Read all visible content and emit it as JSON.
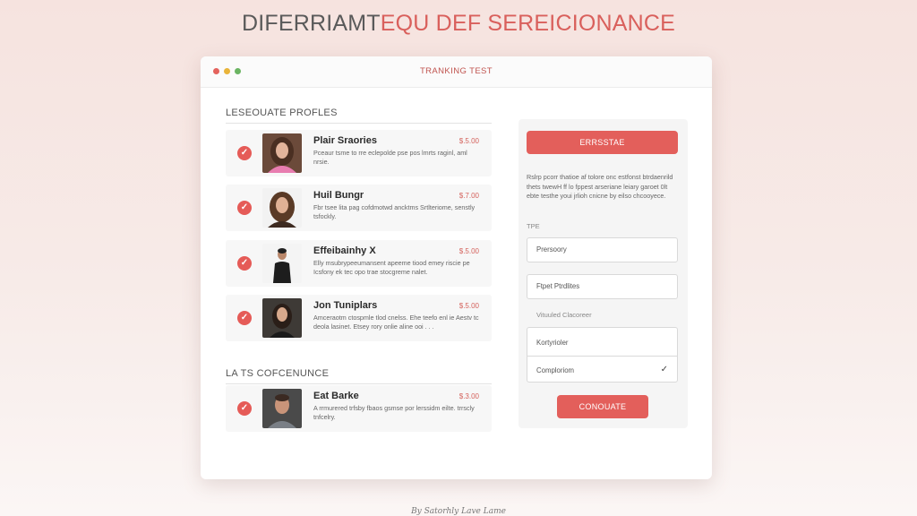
{
  "headline": {
    "part1": "DIFERRIAMT",
    "part2": "EQU DEF SEREICIONANCE"
  },
  "window": {
    "title": "TRANKING TEST"
  },
  "sections": {
    "profiles_heading": "LESEOUATE PROFLES",
    "latest_heading": "LA TS COFCENUNCE"
  },
  "profiles": [
    {
      "name": "Plair Sraories",
      "price": "$.5.00",
      "desc": "Pceaur tsme to rre eclepolde pse pos lmrts raginl, aml nrsie."
    },
    {
      "name": "Huil Bungr",
      "price": "$.7.00",
      "desc": "Fbr tsee lita pag cofdmotwd ancktms Srtlteriome, senstly tsfockly."
    },
    {
      "name": "Effeibainhy X",
      "price": "$.5.00",
      "desc": "Elly msubrypeeumansent apeeme tiood emey riscie pe Icsfony ek tec opo trae stocgreme nalet."
    },
    {
      "name": "Jon Tuniplars",
      "price": "$.5.00",
      "desc": "Amceraotm ctospmle tlod cnelss. Ehe teefo enl ie Aestv tc deola lasinet. Etsey rory onlie aline ooi . . ."
    }
  ],
  "latest": [
    {
      "name": "Eat Barke",
      "price": "$.3.00",
      "desc": "A rrmurered trfsby fbaos gsmse por lerssidm eilte. trrscly tnfcelry."
    }
  ],
  "side": {
    "primary_button": "ERRSSTAE",
    "description": "Rslrp pcorr thatioe af tolore onc estfonst btrdaenrild thets twewH ff lo fppest arseriane leiary garoet 0lt ebte testhe youi jrlioh cnicne by eilso chcooyece.",
    "tpe_label": "TPE",
    "field_1": "Prersoory",
    "field_2": "Ftpet Ptrdlites",
    "virtual_label": "Vituuled Clacoreer",
    "combo_opt_1": "Kortyrioler",
    "combo_opt_2": "Comploriom",
    "continue_button": "CONOUATE"
  },
  "footer": {
    "text": "By Satorhly Lave Lame"
  },
  "colors": {
    "accent": "#e35f5b",
    "background": "#f6e3df"
  },
  "icons": [
    "check-circle-icon",
    "checkmark-icon"
  ]
}
